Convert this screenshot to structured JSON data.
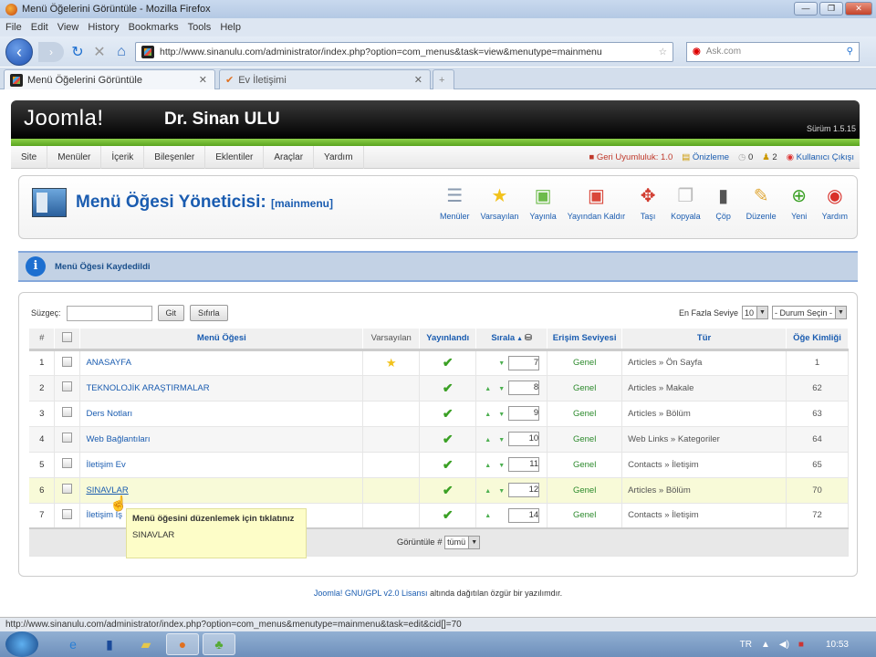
{
  "window": {
    "title": "Menü Öğelerini Görüntüle - Mozilla Firefox"
  },
  "menubar": [
    "File",
    "Edit",
    "View",
    "History",
    "Bookmarks",
    "Tools",
    "Help"
  ],
  "address": {
    "url": "http://www.sinanulu.com/administrator/index.php?option=com_menus&task=view&menutype=mainmenu",
    "search_placeholder": "Ask.com"
  },
  "tabs": [
    {
      "label": "Menü Öğelerini Görüntüle",
      "active": true
    },
    {
      "label": "Ev İletişimi",
      "active": false
    }
  ],
  "header": {
    "logo": "Joomla!",
    "site": "Dr. Sinan ULU",
    "version": "Sürüm 1.5.15"
  },
  "topmenu": [
    "Site",
    "Menüler",
    "İçerik",
    "Bileşenler",
    "Eklentiler",
    "Araçlar",
    "Yardım"
  ],
  "status": {
    "legacy": "Geri Uyumluluk: 1.0",
    "preview": "Önizleme",
    "messages": "0",
    "users": "2",
    "logout": "Kullanıcı Çıkışı"
  },
  "page": {
    "title": "Menü Öğesi Yöneticisi:",
    "menutype": "[mainmenu]"
  },
  "toolbar": [
    {
      "label": "Menüler",
      "icon": "menus-icon",
      "glyph": "☰",
      "color": "#8a9bb0"
    },
    {
      "label": "Varsayılan",
      "icon": "star-icon",
      "glyph": "★",
      "color": "#f2c21b"
    },
    {
      "label": "Yayınla",
      "icon": "publish-icon",
      "glyph": "▣",
      "color": "#6dbb4b"
    },
    {
      "label": "Yayından Kaldır",
      "icon": "unpublish-icon",
      "glyph": "▣",
      "color": "#d9473a"
    },
    {
      "label": "Taşı",
      "icon": "move-icon",
      "glyph": "✥",
      "color": "#d13b2f"
    },
    {
      "label": "Kopyala",
      "icon": "copy-icon",
      "glyph": "❐",
      "color": "#bbb"
    },
    {
      "label": "Çöp",
      "icon": "trash-icon",
      "glyph": "▮",
      "color": "#555"
    },
    {
      "label": "Düzenle",
      "icon": "edit-icon",
      "glyph": "✎",
      "color": "#e0a93a"
    },
    {
      "label": "Yeni",
      "icon": "new-icon",
      "glyph": "⊕",
      "color": "#3aa024"
    },
    {
      "label": "Yardım",
      "icon": "help-icon",
      "glyph": "◉",
      "color": "#d9302a"
    }
  ],
  "message": "Menü Öğesi Kaydedildi",
  "filter": {
    "label": "Süzgeç:",
    "value": "",
    "go": "Git",
    "reset": "Sıfırla",
    "maxlevel_label": "En Fazla Seviye",
    "maxlevel": "10",
    "state": "- Durum Seçin -"
  },
  "columns": [
    "#",
    "Menü Öğesi",
    "Varsayılan",
    "Yayınlandı",
    "Sırala",
    "Erişim Seviyesi",
    "Tür",
    "Öğe Kimliği"
  ],
  "rows": [
    {
      "n": "1",
      "name": "ANASAYFA",
      "default": true,
      "up": false,
      "down": true,
      "order": "7",
      "access": "Genel",
      "type": "Articles » Ön Sayfa",
      "id": "1"
    },
    {
      "n": "2",
      "name": "TEKNOLOJİK ARAŞTIRMALAR",
      "default": false,
      "up": true,
      "down": true,
      "order": "8",
      "access": "Genel",
      "type": "Articles » Makale",
      "id": "62"
    },
    {
      "n": "3",
      "name": "Ders Notları",
      "default": false,
      "up": true,
      "down": true,
      "order": "9",
      "access": "Genel",
      "type": "Articles » Bölüm",
      "id": "63"
    },
    {
      "n": "4",
      "name": "Web Bağlantıları",
      "default": false,
      "up": true,
      "down": true,
      "order": "10",
      "access": "Genel",
      "type": "Web Links » Kategoriler",
      "id": "64"
    },
    {
      "n": "5",
      "name": "İletişim Ev",
      "default": false,
      "up": true,
      "down": true,
      "order": "11",
      "access": "Genel",
      "type": "Contacts » İletişim",
      "id": "65"
    },
    {
      "n": "6",
      "name": "SINAVLAR",
      "default": false,
      "up": true,
      "down": true,
      "order": "12",
      "access": "Genel",
      "type": "Articles » Bölüm",
      "id": "70",
      "hover": true
    },
    {
      "n": "7",
      "name": "İletişim İş",
      "default": false,
      "up": true,
      "down": false,
      "order": "14",
      "access": "Genel",
      "type": "Contacts » İletişim",
      "id": "72"
    }
  ],
  "pager": {
    "label": "Görüntüle #",
    "value": "tümü"
  },
  "tooltip": {
    "title": "Menü öğesini düzenlemek için tıklatınız",
    "body": "SINAVLAR"
  },
  "credit": {
    "link": "Joomla! GNU/GPL v2.0 Lisansı",
    "text": " altında dağıtılan özgür bir yazılımdır."
  },
  "statusbar": "http://www.sinanulu.com/administrator/index.php?option=com_menus&menutype=mainmenu&task=edit&cid[]=70",
  "tray": {
    "lang": "TR",
    "time": "10:53"
  }
}
